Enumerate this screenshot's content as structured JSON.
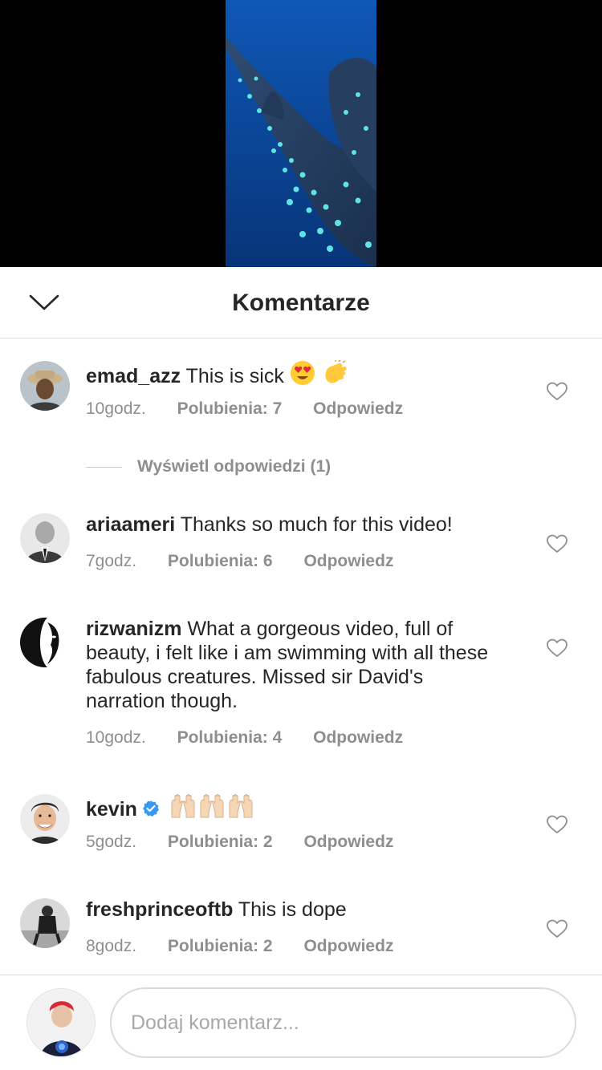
{
  "header": {
    "title": "Komentarze",
    "collapse_icon": "chevron-down-icon"
  },
  "comments": [
    {
      "username": "emad_azz",
      "text": "This is sick",
      "emojis": [
        "heart-eyes",
        "clapping-hands"
      ],
      "time": "10godz.",
      "likes": "Polubienia: 7",
      "reply": "Odpowiedz"
    },
    {
      "username": "ariaameri",
      "text": "Thanks so much for this video!",
      "time": "7godz.",
      "likes": "Polubienia: 6",
      "reply": "Odpowiedz"
    },
    {
      "username": "rizwanizm",
      "text": "What a gorgeous video, full of beauty, i felt like i am swimming with all these fabulous creatures. Missed sir David's narration though.",
      "time": "10godz.",
      "likes": "Polubienia: 4",
      "reply": "Odpowiedz"
    },
    {
      "username": "kevin",
      "verified": true,
      "emojis": [
        "raising-hands",
        "raising-hands",
        "raising-hands"
      ],
      "time": "5godz.",
      "likes": "Polubienia: 2",
      "reply": "Odpowiedz"
    },
    {
      "username": "freshprinceoftb",
      "text": "This is dope",
      "time": "8godz.",
      "likes": "Polubienia: 2",
      "reply": "Odpowiedz"
    }
  ],
  "view_replies": "Wyświetl odpowiedzi (1)",
  "footer": {
    "placeholder": "Dodaj komentarz..."
  },
  "colors": {
    "text": "#262626",
    "meta": "#8e8e8e",
    "divider": "#dbdbdb",
    "verified": "#3897f0",
    "video_water": "#0a3f92"
  }
}
